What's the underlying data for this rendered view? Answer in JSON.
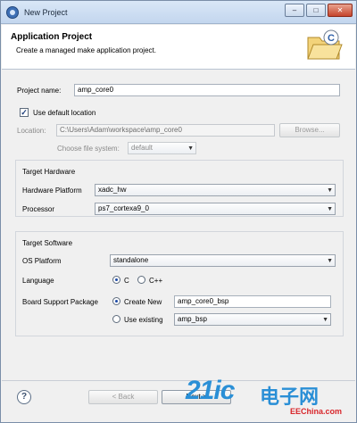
{
  "window": {
    "title": "New Project",
    "minimize": "–",
    "maximize": "□",
    "close": "✕"
  },
  "banner": {
    "title": "Application Project",
    "description": "Create a managed make application project."
  },
  "form": {
    "project_name_label": "Project name:",
    "project_name_value": "amp_core0",
    "use_default_location_label": "Use default location",
    "use_default_location_checked": true,
    "location_label": "Location:",
    "location_value": "C:\\Users\\Adam\\workspace\\amp_core0",
    "browse_label": "Browse...",
    "file_system_label": "Choose file system:",
    "file_system_value": "default"
  },
  "target_hardware": {
    "heading": "Target Hardware",
    "platform_label": "Hardware Platform",
    "platform_value": "xadc_hw",
    "processor_label": "Processor",
    "processor_value": "ps7_cortexa9_0"
  },
  "target_software": {
    "heading": "Target Software",
    "os_label": "OS Platform",
    "os_value": "standalone",
    "language_label": "Language",
    "language_options": [
      "C",
      "C++"
    ],
    "language_selected": "C",
    "bsp_label": "Board Support Package",
    "create_new_label": "Create New",
    "create_new_value": "amp_core0_bsp",
    "use_existing_label": "Use existing",
    "use_existing_value": "amp_bsp",
    "bsp_selected": "Create New"
  },
  "footer": {
    "help": "?",
    "back_label": "< Back",
    "next_label": "Next >"
  },
  "watermark": {
    "logo": "21ic",
    "cn": "电子网",
    "site": "EEChina.com"
  },
  "colors": {
    "accent": "#1d4aa5",
    "watermark_blue": "#2a8fd6",
    "watermark_red": "#d8252a"
  },
  "icons": {
    "app": "eclipse-icon",
    "banner": "folder-c-icon",
    "help": "help-icon"
  }
}
